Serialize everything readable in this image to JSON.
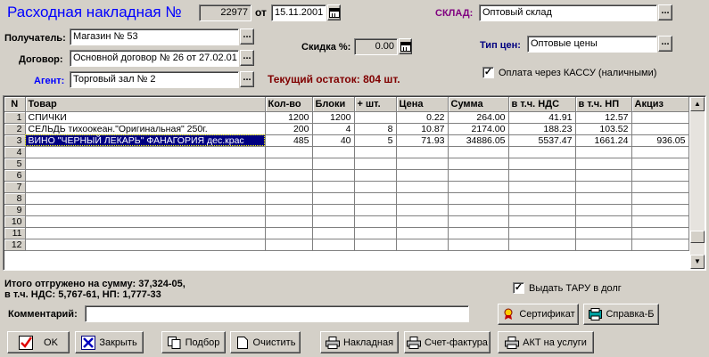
{
  "header": {
    "title": "Расходная накладная №",
    "number": "22977",
    "date_prefix": "от",
    "date": "15.11.2001",
    "warehouse_label": "СКЛАД:",
    "warehouse_value": "Оптовый склад",
    "price_type_label": "Тип цен:",
    "price_type_value": "Оптовые цены"
  },
  "form": {
    "recipient_label": "Получатель:",
    "recipient_value": "Магазин № 53",
    "contract_label": "Договор:",
    "contract_value": "Основной договор № 26 от 27.02.01",
    "agent_label": "Агент:",
    "agent_value": "Торговый зал  № 2",
    "discount_label": "Скидка %:",
    "discount_value": "0.00",
    "stock_text": "Текущий остаток: 804 шт.",
    "cash_payment_label": "Оплата через КАССУ (наличными)",
    "cash_payment_checked": true
  },
  "table": {
    "columns": [
      "N",
      "Товар",
      "Кол-во",
      "Блоки",
      "+ шт.",
      "Цена",
      "Сумма",
      "в т.ч. НДС",
      "в т.ч. НП",
      "Акциз"
    ],
    "rows": [
      [
        "1",
        "СПИЧКИ",
        "1200",
        "1200",
        "",
        "0.22",
        "264.00",
        "41.91",
        "12.57",
        ""
      ],
      [
        "2",
        "СЕЛЬДЬ тихоокеан.\"Оригинальная\" 250г.",
        "200",
        "4",
        "8",
        "10.87",
        "2174.00",
        "188.23",
        "103.52",
        ""
      ],
      [
        "3",
        "ВИНО \"ЧЕРНЫЙ ЛЕКАРЬ\" ФАНАГОРИЯ дес.крас",
        "485",
        "40",
        "5",
        "71.93",
        "34886.05",
        "5537.47",
        "1661.24",
        "936.05"
      ],
      [
        "4",
        "",
        "",
        "",
        "",
        "",
        "",
        "",
        "",
        ""
      ],
      [
        "5",
        "",
        "",
        "",
        "",
        "",
        "",
        "",
        "",
        ""
      ],
      [
        "6",
        "",
        "",
        "",
        "",
        "",
        "",
        "",
        "",
        ""
      ],
      [
        "7",
        "",
        "",
        "",
        "",
        "",
        "",
        "",
        "",
        ""
      ],
      [
        "8",
        "",
        "",
        "",
        "",
        "",
        "",
        "",
        "",
        ""
      ],
      [
        "9",
        "",
        "",
        "",
        "",
        "",
        "",
        "",
        "",
        ""
      ],
      [
        "10",
        "",
        "",
        "",
        "",
        "",
        "",
        "",
        "",
        ""
      ],
      [
        "11",
        "",
        "",
        "",
        "",
        "",
        "",
        "",
        "",
        ""
      ],
      [
        "12",
        "",
        "",
        "",
        "",
        "",
        "",
        "",
        "",
        ""
      ]
    ]
  },
  "footer": {
    "total_line1": "Итого отгружено на сумму: 37,324-05,",
    "total_line2": "в т.ч. НДС: 5,767-61, НП: 1,777-33",
    "return_tare_label": "Выдать ТАРУ в долг",
    "return_tare_checked": true,
    "comment_label": "Комментарий:",
    "comment_value": "",
    "certificate_button": "Сертификат",
    "reference_button": "Справка-Б"
  },
  "buttons": {
    "ok": "OK",
    "close": "Закрыть",
    "pick": "Подбор",
    "clear": "Очистить",
    "waybill": "Накладная",
    "invoice": "Счет-фактура",
    "services_act": "АКТ на услуги"
  },
  "colors": {
    "title": "#0000ff",
    "warehouse_label": "#800080",
    "price_type_label": "#000080",
    "agent_label": "#0000ff",
    "stock_text": "#800000",
    "selection": "#000080"
  }
}
